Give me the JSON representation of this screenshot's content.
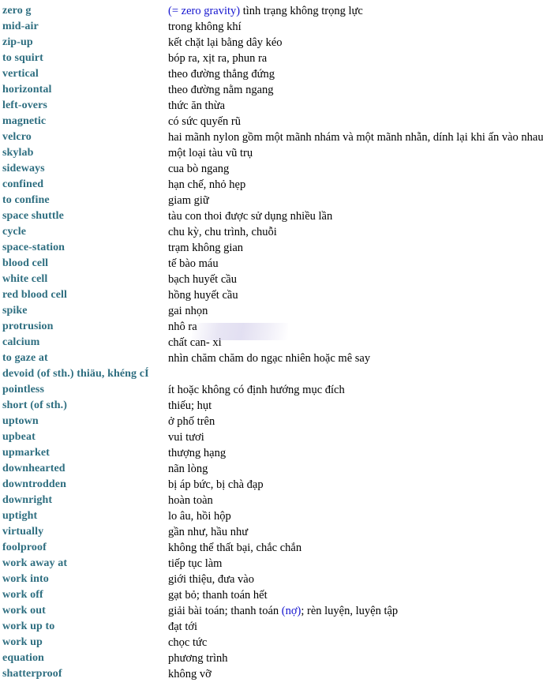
{
  "page": {
    "kind": "bilingual-glossary",
    "term_color": "#2e6e80",
    "definition_color": "#000000",
    "highlight_color": "#1414cf",
    "background_color": "#ffffff"
  },
  "entries": [
    {
      "term": "zero g",
      "def_pre": "",
      "def_alt": "(= zero gravity)",
      "def_post": " tình trạng không trọng lực"
    },
    {
      "term": "mid-air",
      "def_pre": "trong không khí",
      "def_alt": "",
      "def_post": ""
    },
    {
      "term": "zip-up",
      "def_pre": "kết chặt lại bằng dây kéo",
      "def_alt": "",
      "def_post": ""
    },
    {
      "term": "to squirt",
      "def_pre": "bóp ra, xịt ra, phun ra",
      "def_alt": "",
      "def_post": ""
    },
    {
      "term": "vertical",
      "def_pre": "theo đường thẳng đứng",
      "def_alt": "",
      "def_post": ""
    },
    {
      "term": "horizontal",
      "def_pre": "theo đường nằm ngang",
      "def_alt": "",
      "def_post": ""
    },
    {
      "term": "left-overs",
      "def_pre": "thức ăn thừa",
      "def_alt": "",
      "def_post": ""
    },
    {
      "term": "magnetic",
      "def_pre": "có sức quyến rũ",
      "def_alt": "",
      "def_post": ""
    },
    {
      "term": "velcro",
      "def_pre": "hai mãnh nylon gồm một mãnh nhám và một mãnh nhẵn, dính lại khi ấn vào nhau",
      "def_alt": "",
      "def_post": ""
    },
    {
      "term": "skylab",
      "def_pre": "một loại tàu vũ trụ",
      "def_alt": "",
      "def_post": ""
    },
    {
      "term": "sideways",
      "def_pre": "cua bò ngang",
      "def_alt": "",
      "def_post": ""
    },
    {
      "term": "confined",
      "def_pre": "hạn chế, nhỏ hẹp",
      "def_alt": "",
      "def_post": ""
    },
    {
      "term": "to confine",
      "def_pre": "giam giữ",
      "def_alt": "",
      "def_post": ""
    },
    {
      "term": "space shuttle",
      "def_pre": "tàu con thoi được sử dụng nhiều lần",
      "def_alt": "",
      "def_post": ""
    },
    {
      "term": "cycle",
      "def_pre": "chu kỳ, chu trình, chuỗi",
      "def_alt": "",
      "def_post": ""
    },
    {
      "term": "space-station",
      "def_pre": "trạm không gian",
      "def_alt": "",
      "def_post": ""
    },
    {
      "term": "blood cell",
      "def_pre": "tế bào máu",
      "def_alt": "",
      "def_post": ""
    },
    {
      "term": "white cell",
      "def_pre": "bạch huyết cầu",
      "def_alt": "",
      "def_post": ""
    },
    {
      "term": "red blood cell",
      "def_pre": "hồng huyết cầu",
      "def_alt": "",
      "def_post": ""
    },
    {
      "term": "spike",
      "def_pre": "gai nhọn",
      "def_alt": "",
      "def_post": ""
    },
    {
      "term": "protrusion",
      "def_pre": "nhô ra",
      "def_alt": "",
      "def_post": ""
    },
    {
      "term": "calcium",
      "def_pre": "chất can- xi",
      "def_alt": "",
      "def_post": ""
    },
    {
      "term": "to gaze at",
      "def_pre": "nhìn chăm chăm do ngạc nhiên hoặc mê say",
      "def_alt": "",
      "def_post": ""
    },
    {
      "term": "devoid (of sth.) thiäu, khéng cÍ",
      "def_pre": "",
      "def_alt": "",
      "def_post": ""
    },
    {
      "term": "pointless",
      "def_pre": "ít hoặc không có định hướng mục đích",
      "def_alt": "",
      "def_post": ""
    },
    {
      "term": "short (of sth.)",
      "def_pre": "thiếu; hụt",
      "def_alt": "",
      "def_post": ""
    },
    {
      "term": "uptown",
      "def_pre": "ở phố trên",
      "def_alt": "",
      "def_post": ""
    },
    {
      "term": "upbeat",
      "def_pre": "vui tươi",
      "def_alt": "",
      "def_post": ""
    },
    {
      "term": "upmarket",
      "def_pre": "thượng hạng",
      "def_alt": "",
      "def_post": ""
    },
    {
      "term": "downhearted",
      "def_pre": "nãn lòng",
      "def_alt": "",
      "def_post": ""
    },
    {
      "term": "downtrodden",
      "def_pre": "bị áp bức, bị chà đạp",
      "def_alt": "",
      "def_post": ""
    },
    {
      "term": "downright",
      "def_pre": "hoàn toàn",
      "def_alt": "",
      "def_post": ""
    },
    {
      "term": "uptight",
      "def_pre": "lo âu, hồi hộp",
      "def_alt": "",
      "def_post": ""
    },
    {
      "term": "virtually",
      "def_pre": "gần như, hầu như",
      "def_alt": "",
      "def_post": ""
    },
    {
      "term": "foolproof",
      "def_pre": "không thể thất bại, chắc chắn",
      "def_alt": "",
      "def_post": ""
    },
    {
      "term": "work away at",
      "def_pre": "tiếp tục làm",
      "def_alt": "",
      "def_post": ""
    },
    {
      "term": "work into",
      "def_pre": "giới thiệu, đưa vào",
      "def_alt": "",
      "def_post": ""
    },
    {
      "term": "work off",
      "def_pre": "gạt bỏ; thanh toán hết",
      "def_alt": "",
      "def_post": ""
    },
    {
      "term": "work out",
      "def_pre": "giải bài toán; thanh toán ",
      "def_alt": "(nợ)",
      "def_post": "; rèn luyện, luyện tập"
    },
    {
      "term": "work up to",
      "def_pre": "đạt tới",
      "def_alt": "",
      "def_post": ""
    },
    {
      "term": "work up",
      "def_pre": "chọc tức",
      "def_alt": "",
      "def_post": ""
    },
    {
      "term": "equation",
      "def_pre": "phương trình",
      "def_alt": "",
      "def_post": ""
    },
    {
      "term": "shatterproof",
      "def_pre": "không vỡ",
      "def_alt": "",
      "def_post": ""
    }
  ]
}
